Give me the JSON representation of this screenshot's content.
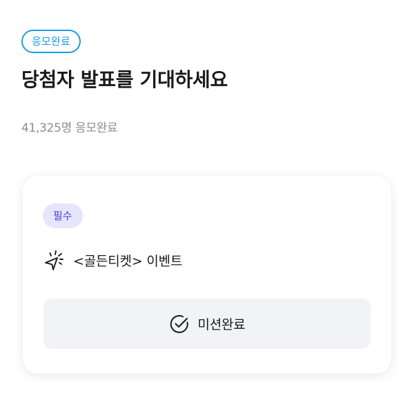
{
  "status_badge": "응모완료",
  "title": "당첨자 발표를 기대하세요",
  "participant_count": "41,325명 응모완료",
  "mission_card": {
    "required_badge": "필수",
    "mission_icon": "sparkle-pointer-icon",
    "mission_title": "<골든티켓> 이벤트",
    "button_icon": "check-circle-icon",
    "button_label": "미션완료"
  },
  "colors": {
    "accent_blue": "#1a9be8",
    "badge_bg": "#e6e6fb",
    "badge_text": "#4b3bd6",
    "muted_text": "#8a8d93",
    "button_bg": "#f2f3f6"
  }
}
